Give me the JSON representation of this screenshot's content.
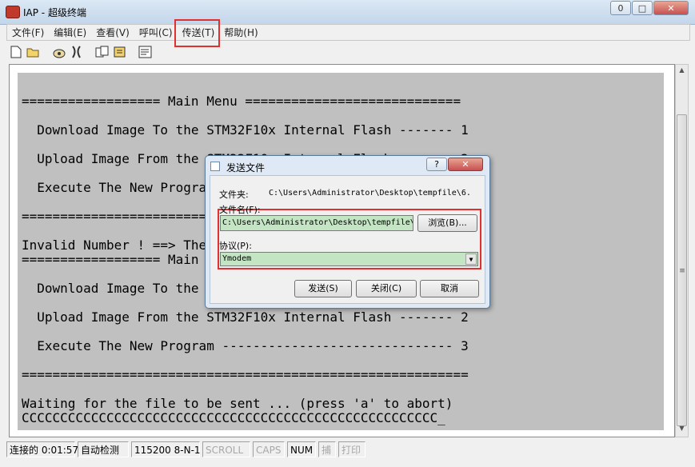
{
  "window": {
    "title": "IAP - 超级终端",
    "minimize": "0",
    "maximize": "□",
    "close": "✕"
  },
  "menu": [
    "文件(F)",
    "编辑(E)",
    "查看(V)",
    "呼叫(C)",
    "传送(T)",
    "帮助(H)"
  ],
  "toolbar": [
    "new-icon",
    "open-icon",
    "dial-icon",
    "disconnect-icon",
    "send-icon",
    "receive-icon",
    "properties-icon"
  ],
  "terminal": {
    "lines": [
      "================== Main Menu ============================",
      "  Download Image To the STM32F10x Internal Flash ------- 1",
      "  Upload Image From the STM32F10x Internal Flash ------- 2",
      "  Execute The New Program ------------------------------ 3",
      "==========================================================",
      "Invalid Number ! ==> The number should be either 1, 2 or 3",
      "================== Main Menu ============================",
      "  Download Image To the STM32F10x Internal Flash ------- 1",
      "  Upload Image From the STM32F10x Internal Flash ------- 2",
      "  Execute The New Program ------------------------------ 3",
      "==========================================================",
      "Waiting for the file to be sent ... (press 'a' to abort)",
      "CCCCCCCCCCCCCCCCCCCCCCCCCCCCCCCCCCCCCCCCCCCCCCCCCCCCCC_"
    ]
  },
  "status": {
    "connected": "连接的 0:01:57",
    "detect": "自动检测",
    "baud": "115200 8-N-1",
    "scroll": "SCROLL",
    "caps": "CAPS",
    "num": "NUM",
    "capture": "捕",
    "print": "打印"
  },
  "dialog": {
    "title": "发送文件",
    "help": "?",
    "close": "✕",
    "folder_label": "文件夹:",
    "folder_value": "C:\\Users\\Administrator\\Desktop\\tempfile\\6.",
    "filename_label": "文件名(F):",
    "filename_value": "C:\\Users\\Administrator\\Desktop\\tempfile\\",
    "browse": "浏览(B)...",
    "protocol_label": "协议(P):",
    "protocol_value": "Ymodem",
    "send": "发送(S)",
    "close_btn": "关闭(C)",
    "cancel": "取消"
  },
  "colors": {
    "terminal_bg": "#c0c0c0",
    "highlight": "#e03030",
    "input_bg": "#c4e5c4"
  }
}
